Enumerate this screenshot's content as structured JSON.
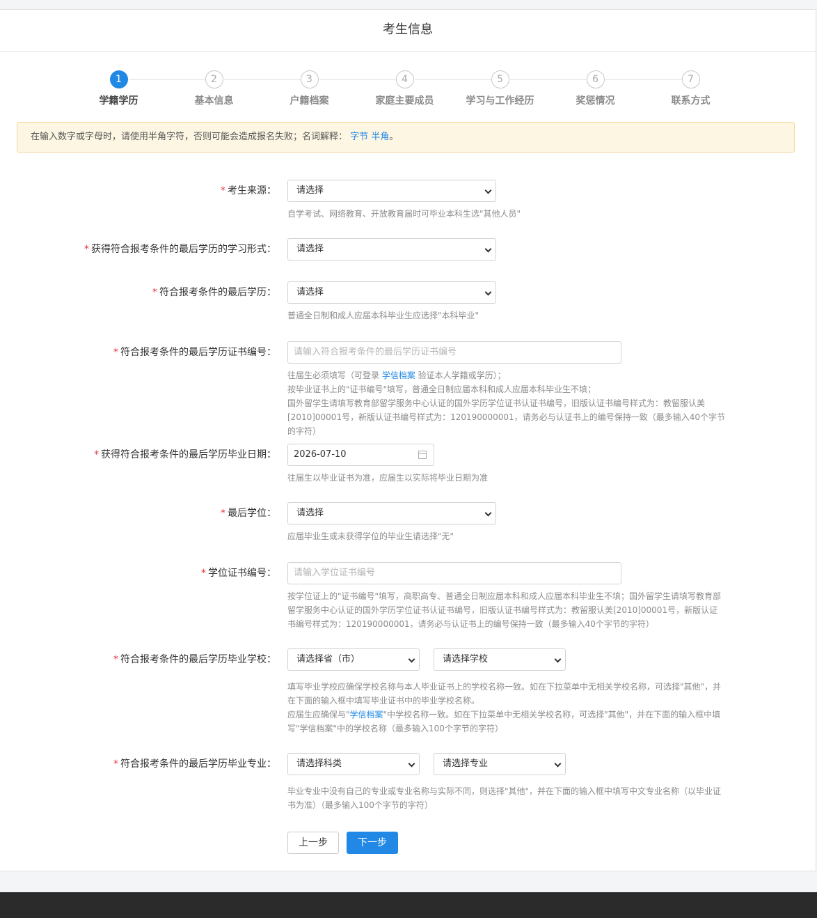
{
  "header": {
    "title": "考生信息"
  },
  "steps": [
    {
      "num": "1",
      "label": "学籍学历"
    },
    {
      "num": "2",
      "label": "基本信息"
    },
    {
      "num": "3",
      "label": "户籍档案"
    },
    {
      "num": "4",
      "label": "家庭主要成员"
    },
    {
      "num": "5",
      "label": "学习与工作经历"
    },
    {
      "num": "6",
      "label": "奖惩情况"
    },
    {
      "num": "7",
      "label": "联系方式"
    }
  ],
  "notice": {
    "text": "在输入数字或字母时，请使用半角字符，否则可能会造成报名失败；名词解释：",
    "link1": "字节",
    "link2": "半角",
    "tail": "。"
  },
  "form": {
    "source": {
      "label": "考生来源：",
      "value": "请选择",
      "hint": "自学考试、网络教育、开放教育届时可毕业本科生选\"其他人员\""
    },
    "study_form": {
      "label": "获得符合报考条件的最后学历的学习形式：",
      "value": "请选择"
    },
    "last_edu": {
      "label": "符合报考条件的最后学历：",
      "value": "请选择",
      "hint": "普通全日制和成人应届本科毕业生应选择\"本科毕业\""
    },
    "cert_no": {
      "label": "符合报考条件的最后学历证书编号：",
      "placeholder": "请输入符合报考条件的最后学历证书编号",
      "hint1_a": "往届生必须填写（可登录 ",
      "hint1_link": "学信档案",
      "hint1_b": " 验证本人学籍或学历）；",
      "hint2": "按毕业证书上的\"证书编号\"填写，普通全日制应届本科和成人应届本科毕业生不填；",
      "hint3": "国外留学生请填写教育部留学服务中心认证的国外学历学位证书认证书编号，旧版认证书编号样式为：教留服认美[2010]00001号，新版认证书编号样式为：120190000001，请务必与认证书上的编号保持一致（最多输入40个字节的字符）"
    },
    "grad_date": {
      "label": "获得符合报考条件的最后学历毕业日期：",
      "value": "2026-07-10",
      "hint": "往届生以毕业证书为准，应届生以实际将毕业日期为准"
    },
    "degree": {
      "label": "最后学位：",
      "value": "请选择",
      "hint": "应届毕业生或未获得学位的毕业生请选择\"无\""
    },
    "degree_no": {
      "label": "学位证书编号：",
      "placeholder": "请输入学位证书编号",
      "hint": "按学位证上的\"证书编号\"填写，高职高专、普通全日制应届本科和成人应届本科毕业生不填；国外留学生请填写教育部留学服务中心认证的国外学历学位证书认证书编号，旧版认证书编号样式为：教留服认美[2010]00001号，新版认证书编号样式为：120190000001，请务必与认证书上的编号保持一致（最多输入40个字节的字符）"
    },
    "school": {
      "label": "符合报考条件的最后学历毕业学校：",
      "province": "请选择省（市）",
      "school": "请选择学校",
      "hint1": "填写毕业学校应确保学校名称与本人毕业证书上的学校名称一致。如在下拉菜单中无相关学校名称，可选择\"其他\"，并在下面的输入框中填写毕业证书中的毕业学校名称。",
      "hint2_a": "应届生应确保与\"",
      "hint2_link": "学信档案",
      "hint2_b": "\"中学校名称一致。如在下拉菜单中无相关学校名称，可选择\"其他\"，并在下面的输入框中填写\"学信档案\"中的学校名称（最多输入100个字节的字符）"
    },
    "major": {
      "label": "符合报考条件的最后学历毕业专业：",
      "category": "请选择科类",
      "major": "请选择专业",
      "hint": "毕业专业中没有自己的专业或专业名称与实际不同，则选择\"其他\"，并在下面的输入框中填写中文专业名称（以毕业证书为准）（最多输入100个字节的字符）"
    }
  },
  "buttons": {
    "prev": "上一步",
    "next": "下一步"
  },
  "colors": {
    "primary": "#2189e5",
    "required": "#e4393c",
    "notice_bg": "#fdf6e3"
  }
}
